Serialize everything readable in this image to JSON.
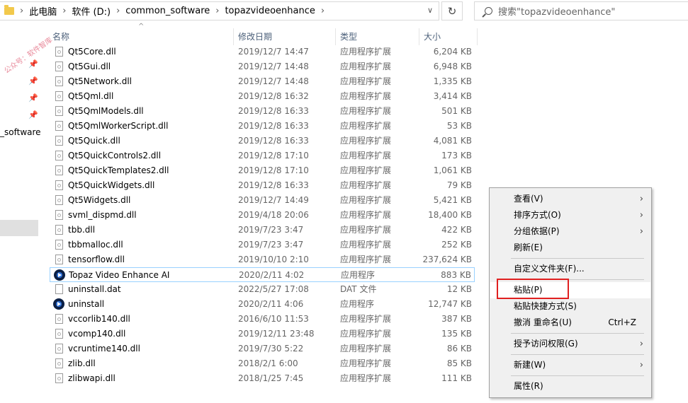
{
  "address": {
    "crumbs": [
      "此电脑",
      "软件 (D:)",
      "common_software",
      "topazvideoenhance"
    ]
  },
  "search": {
    "placeholder": "搜索\"topazvideoenhance\""
  },
  "nav": {
    "label": "_software",
    "watermark": "公众号：软件智库"
  },
  "columns": {
    "name": "名称",
    "date": "修改日期",
    "type": "类型",
    "size": "大小"
  },
  "files": [
    {
      "name": "Qt5Core.dll",
      "date": "2019/12/7 14:47",
      "type": "应用程序扩展",
      "size": "6,204 KB",
      "icon": "dll-file-icon"
    },
    {
      "name": "Qt5Gui.dll",
      "date": "2019/12/7 14:48",
      "type": "应用程序扩展",
      "size": "6,948 KB",
      "icon": "dll-file-icon"
    },
    {
      "name": "Qt5Network.dll",
      "date": "2019/12/7 14:48",
      "type": "应用程序扩展",
      "size": "1,335 KB",
      "icon": "dll-file-icon"
    },
    {
      "name": "Qt5Qml.dll",
      "date": "2019/12/8 16:32",
      "type": "应用程序扩展",
      "size": "3,414 KB",
      "icon": "dll-file-icon"
    },
    {
      "name": "Qt5QmlModels.dll",
      "date": "2019/12/8 16:33",
      "type": "应用程序扩展",
      "size": "501 KB",
      "icon": "dll-file-icon"
    },
    {
      "name": "Qt5QmlWorkerScript.dll",
      "date": "2019/12/8 16:33",
      "type": "应用程序扩展",
      "size": "53 KB",
      "icon": "dll-file-icon"
    },
    {
      "name": "Qt5Quick.dll",
      "date": "2019/12/8 16:33",
      "type": "应用程序扩展",
      "size": "4,081 KB",
      "icon": "dll-file-icon"
    },
    {
      "name": "Qt5QuickControls2.dll",
      "date": "2019/12/8 17:10",
      "type": "应用程序扩展",
      "size": "173 KB",
      "icon": "dll-file-icon"
    },
    {
      "name": "Qt5QuickTemplates2.dll",
      "date": "2019/12/8 17:10",
      "type": "应用程序扩展",
      "size": "1,061 KB",
      "icon": "dll-file-icon"
    },
    {
      "name": "Qt5QuickWidgets.dll",
      "date": "2019/12/8 16:33",
      "type": "应用程序扩展",
      "size": "79 KB",
      "icon": "dll-file-icon"
    },
    {
      "name": "Qt5Widgets.dll",
      "date": "2019/12/7 14:49",
      "type": "应用程序扩展",
      "size": "5,421 KB",
      "icon": "dll-file-icon"
    },
    {
      "name": "svml_dispmd.dll",
      "date": "2019/4/18 20:06",
      "type": "应用程序扩展",
      "size": "18,400 KB",
      "icon": "dll-file-icon"
    },
    {
      "name": "tbb.dll",
      "date": "2019/7/23 3:47",
      "type": "应用程序扩展",
      "size": "422 KB",
      "icon": "dll-file-icon"
    },
    {
      "name": "tbbmalloc.dll",
      "date": "2019/7/23 3:47",
      "type": "应用程序扩展",
      "size": "252 KB",
      "icon": "dll-file-icon"
    },
    {
      "name": "tensorflow.dll",
      "date": "2019/10/10 2:10",
      "type": "应用程序扩展",
      "size": "237,624 KB",
      "icon": "dll-file-icon"
    },
    {
      "name": "Topaz Video Enhance AI",
      "date": "2020/2/11 4:02",
      "type": "应用程序",
      "size": "883 KB",
      "icon": "topaz-app-icon",
      "selected": true
    },
    {
      "name": "uninstall.dat",
      "date": "2022/5/27 17:08",
      "type": "DAT 文件",
      "size": "12 KB",
      "icon": "blank-file-icon"
    },
    {
      "name": "uninstall",
      "date": "2020/2/11 4:06",
      "type": "应用程序",
      "size": "12,747 KB",
      "icon": "topaz-app-icon"
    },
    {
      "name": "vccorlib140.dll",
      "date": "2016/6/10 11:53",
      "type": "应用程序扩展",
      "size": "387 KB",
      "icon": "dll-file-icon"
    },
    {
      "name": "vcomp140.dll",
      "date": "2019/12/11 23:48",
      "type": "应用程序扩展",
      "size": "135 KB",
      "icon": "dll-file-icon"
    },
    {
      "name": "vcruntime140.dll",
      "date": "2019/7/30 5:22",
      "type": "应用程序扩展",
      "size": "86 KB",
      "icon": "dll-file-icon"
    },
    {
      "name": "zlib.dll",
      "date": "2018/2/1 6:00",
      "type": "应用程序扩展",
      "size": "85 KB",
      "icon": "dll-file-icon"
    },
    {
      "name": "zlibwapi.dll",
      "date": "2018/1/25 7:45",
      "type": "应用程序扩展",
      "size": "111 KB",
      "icon": "dll-file-icon"
    }
  ],
  "context_menu": [
    {
      "label": "查看(V)",
      "submenu": true
    },
    {
      "label": "排序方式(O)",
      "submenu": true
    },
    {
      "label": "分组依据(P)",
      "submenu": true
    },
    {
      "label": "刷新(E)"
    },
    {
      "separator": true
    },
    {
      "label": "自定义文件夹(F)..."
    },
    {
      "separator": true
    },
    {
      "label": "粘贴(P)",
      "hover": true
    },
    {
      "label": "粘贴快捷方式(S)"
    },
    {
      "label": "撤消 重命名(U)",
      "shortcut": "Ctrl+Z"
    },
    {
      "separator": true
    },
    {
      "label": "授予访问权限(G)",
      "submenu": true
    },
    {
      "separator": true
    },
    {
      "label": "新建(W)",
      "submenu": true
    },
    {
      "separator": true
    },
    {
      "label": "属性(R)"
    }
  ],
  "colors": {
    "highlight_border": "#e02020",
    "selection_border": "#99d1ff",
    "header_text": "#4c607a"
  }
}
